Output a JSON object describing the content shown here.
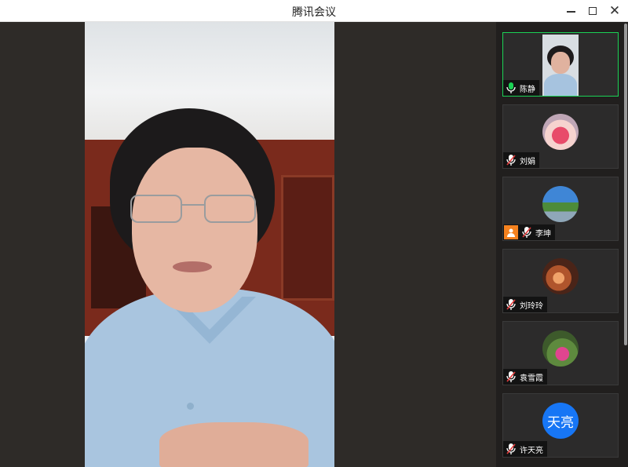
{
  "window": {
    "title": "腾讯会议",
    "controls": [
      "minimize-icon",
      "maximize-icon",
      "close-icon"
    ]
  },
  "main_video": {
    "speaker": "陈静"
  },
  "participants": [
    {
      "name": "陈静",
      "mic": "on",
      "video": "on",
      "active_speaker": true
    },
    {
      "name": "刘娟",
      "mic": "muted",
      "avatar": "strawberry-cake-photo"
    },
    {
      "name": "李坤",
      "mic": "muted",
      "avatar": "park-tree-photo",
      "role_badge": "host-person-icon"
    },
    {
      "name": "刘玲玲",
      "mic": "muted",
      "avatar": "indoor-portrait-photo"
    },
    {
      "name": "袁雪霞",
      "mic": "muted",
      "avatar": "pink-flower-photo"
    },
    {
      "name": "许天亮",
      "mic": "muted",
      "avatar_text": "天亮"
    }
  ],
  "colors": {
    "active_border": "#1bd255",
    "text_avatar_bg": "#1776f5",
    "host_badge": "#f5821f",
    "muted_mic": "#e23b3b",
    "background": "#2e2b28"
  }
}
